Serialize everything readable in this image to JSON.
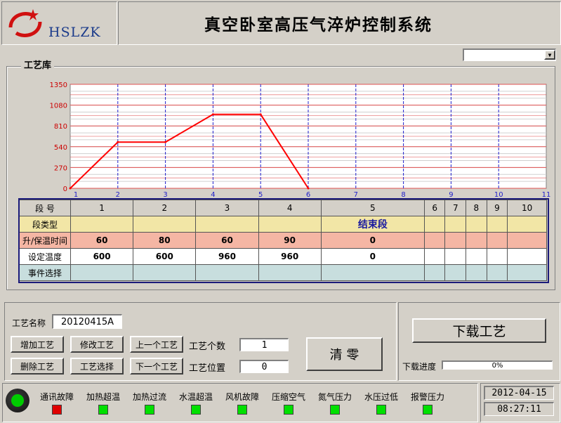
{
  "header": {
    "logo_text": "HSLZK",
    "title": "真空卧室高压气淬炉控制系统"
  },
  "dropdown": {
    "value": ""
  },
  "library": {
    "title": "工艺库"
  },
  "chart_data": {
    "type": "line",
    "x": [
      1,
      2,
      3,
      4,
      5,
      6
    ],
    "values": [
      0,
      600,
      600,
      960,
      960,
      0
    ],
    "xticks": [
      "1",
      "2",
      "3",
      "4",
      "5",
      "6",
      "7",
      "8",
      "9",
      "10",
      "11"
    ],
    "yticks": [
      "0",
      "270",
      "540",
      "810",
      "1080",
      "1350"
    ],
    "ylim": [
      0,
      1350
    ],
    "xlim": [
      1,
      11
    ],
    "grid": true,
    "colors": {
      "line": "#ff0000",
      "hgrid": "#e05050",
      "vgrid": "#2020cc",
      "ytick": "#cc0000",
      "xtick": "#2020cc"
    }
  },
  "table": {
    "row_labels": [
      "段  号",
      "段类型",
      "升/保温时间",
      "设定温度",
      "事件选择"
    ],
    "segments": [
      "1",
      "2",
      "3",
      "4",
      "5",
      "6",
      "7",
      "8",
      "9",
      "10"
    ],
    "types": [
      "",
      "",
      "",
      "",
      "结束段",
      "",
      "",
      "",
      "",
      ""
    ],
    "times": [
      "60",
      "80",
      "60",
      "90",
      "0",
      "",
      "",
      "",
      "",
      ""
    ],
    "temps": [
      "600",
      "600",
      "960",
      "960",
      "0",
      "",
      "",
      "",
      "",
      ""
    ]
  },
  "controls": {
    "name_label": "工艺名称",
    "name_value": "20120415A",
    "add_label": "增加工艺",
    "modify_label": "修改工艺",
    "delete_label": "删除工艺",
    "select_label": "工艺选择",
    "prev_label": "上一个工艺",
    "next_label": "下一个工艺",
    "count_label": "工艺个数",
    "count_value": "1",
    "position_label": "工艺位置",
    "position_value": "0",
    "clear_label": "清  零"
  },
  "download": {
    "button_label": "下载工艺",
    "progress_label": "下载进度",
    "progress_text": "0%",
    "progress_value": 0
  },
  "alarms": [
    {
      "label": "通讯故障",
      "color": "#e00000"
    },
    {
      "label": "加热超温",
      "color": "#00e000"
    },
    {
      "label": "加热过流",
      "color": "#00e000"
    },
    {
      "label": "水温超温",
      "color": "#00e000"
    },
    {
      "label": "风机故障",
      "color": "#00e000"
    },
    {
      "label": "压缩空气",
      "color": "#00e000"
    },
    {
      "label": "氮气压力",
      "color": "#00e000"
    },
    {
      "label": "水压过低",
      "color": "#00e000"
    },
    {
      "label": "报警压力",
      "color": "#00e000"
    }
  ],
  "status": {
    "date": "2012-04-15",
    "time": "08:27:11",
    "run_led_color": "#00cc00"
  }
}
